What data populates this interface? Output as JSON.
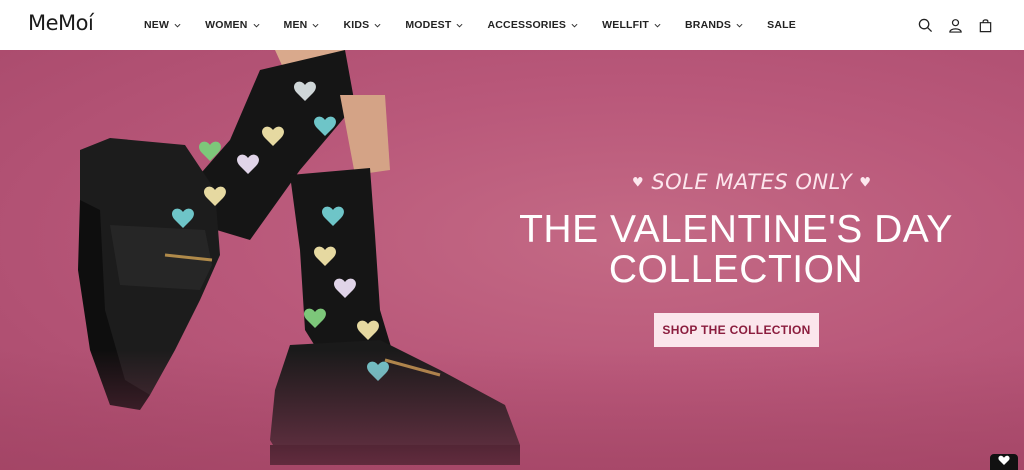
{
  "brand": {
    "logo_text": "MeMoí"
  },
  "nav": {
    "items": [
      {
        "label": "NEW",
        "has_dropdown": true
      },
      {
        "label": "WOMEN",
        "has_dropdown": true
      },
      {
        "label": "MEN",
        "has_dropdown": true
      },
      {
        "label": "KIDS",
        "has_dropdown": true
      },
      {
        "label": "MODEST",
        "has_dropdown": true
      },
      {
        "label": "ACCESSORIES",
        "has_dropdown": true
      },
      {
        "label": "WELLFIT",
        "has_dropdown": true
      },
      {
        "label": "BRANDS",
        "has_dropdown": true
      },
      {
        "label": "SALE",
        "has_dropdown": false
      }
    ]
  },
  "tools": {
    "icons": [
      "search-icon",
      "account-icon",
      "cart-icon"
    ]
  },
  "hero": {
    "tagline": "SOLE MATES ONLY",
    "headline_line1": "THE VALENTINE'S DAY",
    "headline_line2": "COLLECTION",
    "cta_label": "SHOP THE COLLECTION",
    "colors": {
      "background": "#b9587a",
      "cta_bg": "#fbe6ec",
      "cta_text": "#8b1d3e",
      "text": "#ffffff"
    }
  },
  "widgets": {
    "floating_button_icon": "heart-icon"
  }
}
